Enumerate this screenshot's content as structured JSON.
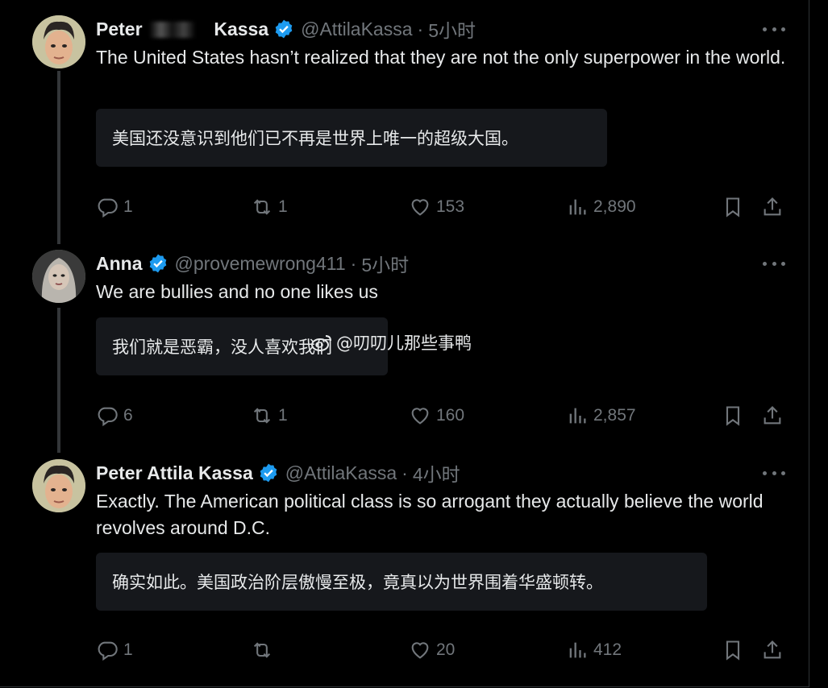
{
  "colors": {
    "background": "#000000",
    "text": "#e7e9ea",
    "muted": "#71767b",
    "verified": "#1d9bf0",
    "translation_bg": "#16181c"
  },
  "tweets": [
    {
      "name": "Peter",
      "name_end": "Kassa",
      "handle": "@AttilaKassa",
      "sep": "·",
      "time": "5小时",
      "text": "The United States hasn’t realized that they are not the only superpower in the world.",
      "translation": "美国还没意识到他们已不再是世界上唯一的超级大国。",
      "replies": "1",
      "reposts": "1",
      "likes": "153",
      "views": "2,890"
    },
    {
      "name": "Anna",
      "handle": "@provemewrong411",
      "sep": "·",
      "time": "5小时",
      "text": "We are bullies and no one likes us",
      "translation": "我们就是恶霸，没人喜欢我们",
      "replies": "6",
      "reposts": "1",
      "likes": "160",
      "views": "2,857"
    },
    {
      "name": "Peter Attila Kassa",
      "handle": "@AttilaKassa",
      "sep": "·",
      "time": "4小时",
      "text": "Exactly. The American political class is so arrogant they actually believe the world revolves around D.C.",
      "translation": "确实如此。美国政治阶层傲慢至极，竟真以为世界围着华盛顿转。",
      "replies": "1",
      "reposts": "",
      "likes": "20",
      "views": "412"
    }
  ],
  "watermark": {
    "text": "@叨叨儿那些事鸭",
    "icon": "weibo-icon"
  }
}
